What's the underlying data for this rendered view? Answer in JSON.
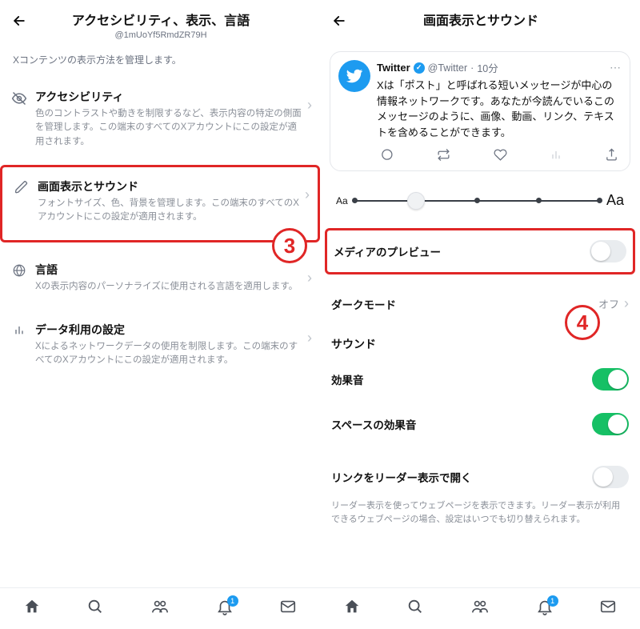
{
  "left": {
    "title": "アクセシビリティ、表示、言語",
    "handle": "@1mUoYf5RmdZR79H",
    "caption": "Xコンテンツの表示方法を管理します。",
    "rows": [
      {
        "icon": "eye-off",
        "title": "アクセシビリティ",
        "desc": "色のコントラストや動きを制限するなど、表示内容の特定の側面を管理します。この端末のすべてのXアカウントにこの設定が適用されます。",
        "highlight": false
      },
      {
        "icon": "pencil",
        "title": "画面表示とサウンド",
        "desc": "フォントサイズ、色、背景を管理します。この端末のすべてのXアカウントにこの設定が適用されます。",
        "highlight": true
      },
      {
        "icon": "globe",
        "title": "言語",
        "desc": "Xの表示内容のパーソナライズに使用される言語を適用します。",
        "highlight": false
      },
      {
        "icon": "bars",
        "title": "データ利用の設定",
        "desc": "Xによるネットワークデータの使用を制限します。この端末のすべてのXアカウントにこの設定が適用されます。",
        "highlight": false
      }
    ],
    "step_label": "3"
  },
  "right": {
    "title": "画面表示とサウンド",
    "tweet": {
      "name": "Twitter",
      "handle": "@Twitter",
      "time": "10分",
      "text": "Xは「ポスト」と呼ばれる短いメッセージが中心の情報ネットワークです。あなたが今読んでいるこのメッセージのように、画像、動画、リンク、テキストを含めることができます。"
    },
    "slider": {
      "min_label": "Aa",
      "max_label": "Aa",
      "aria": "font-size-slider",
      "value_index": 1,
      "steps": 5
    },
    "media_preview": {
      "label": "メディアのプレビュー",
      "on": false
    },
    "dark_mode": {
      "label": "ダークモード",
      "value": "オフ"
    },
    "sound_section": "サウンド",
    "sound_effects": {
      "label": "効果音",
      "on": true
    },
    "spaces_effects": {
      "label": "スペースの効果音",
      "on": true
    },
    "reader": {
      "label": "リンクをリーダー表示で開く",
      "on": false,
      "note": "リーダー表示を使ってウェブページを表示できます。リーダー表示が利用できるウェブページの場合、設定はいつでも切り替えられます。"
    },
    "step_label": "4"
  },
  "bottomnav": {
    "badge": "1"
  }
}
